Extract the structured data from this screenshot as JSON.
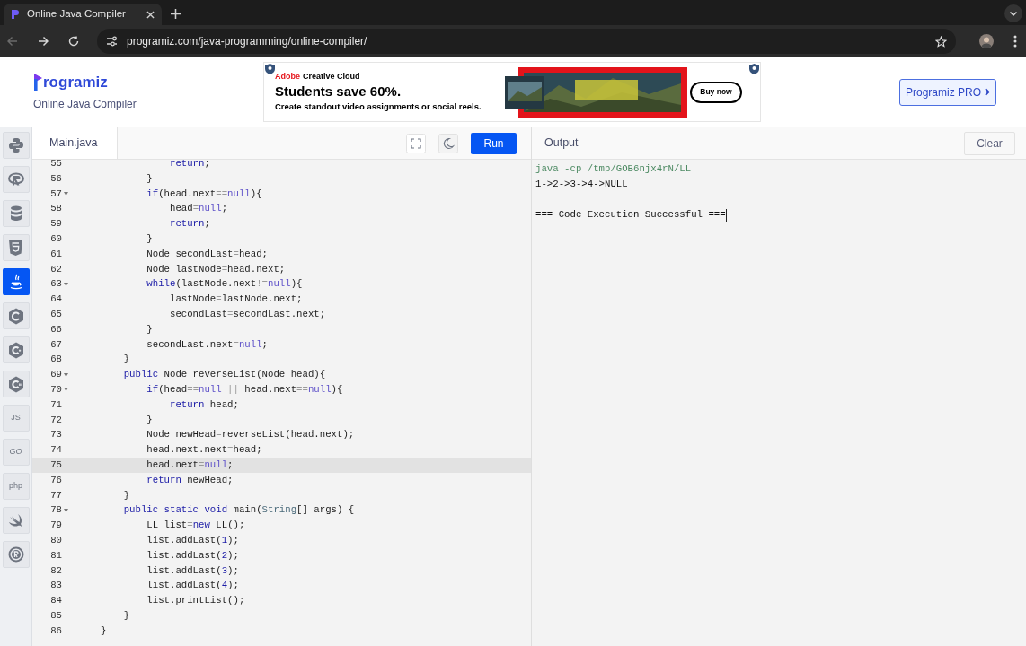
{
  "browser": {
    "tabs": [
      {
        "title": "Online Java Compiler",
        "selected": true
      }
    ],
    "url": "programiz.com/java-programming/online-compiler/",
    "back_disabled": true
  },
  "site_header": {
    "logo": "rogramiz",
    "subtitle": "Online Java Compiler",
    "pro_button": "Programiz PRO"
  },
  "ad": {
    "brand": "Adobe",
    "product": "Creative Cloud",
    "headline": "Students save 60%.",
    "subline": "Create standout video assignments or social reels.",
    "cta": "Buy now"
  },
  "sidebar": {
    "items": [
      {
        "kind": "python",
        "selected": false
      },
      {
        "kind": "r",
        "selected": false
      },
      {
        "kind": "database",
        "selected": false
      },
      {
        "kind": "html",
        "selected": false
      },
      {
        "kind": "java",
        "selected": true
      },
      {
        "kind": "c",
        "selected": false
      },
      {
        "kind": "cpp",
        "selected": false
      },
      {
        "kind": "csharp",
        "selected": false
      },
      {
        "kind": "text",
        "label": "JS",
        "selected": false
      },
      {
        "kind": "text",
        "label": "GO",
        "selected": false
      },
      {
        "kind": "text",
        "label": "php",
        "selected": false
      },
      {
        "kind": "swift",
        "selected": false
      },
      {
        "kind": "rust",
        "selected": false
      }
    ]
  },
  "editor": {
    "file_tab": "Main.java",
    "run_button": "Run",
    "lines": [
      {
        "number": "55",
        "foldable": false,
        "current": false,
        "tokens": [
          {
            "kind": "kw",
            "text": "            return"
          },
          {
            "kind": "p",
            "text": ";"
          }
        ]
      },
      {
        "number": "56",
        "foldable": false,
        "current": false,
        "tokens": [
          {
            "kind": "p",
            "text": "        }"
          }
        ]
      },
      {
        "number": "57",
        "foldable": true,
        "current": false,
        "tokens": [
          {
            "kind": "kw",
            "text": "        if"
          },
          {
            "kind": "p",
            "text": "(head.next"
          },
          {
            "kind": "op",
            "text": "=="
          },
          {
            "kind": "at",
            "text": "null"
          },
          {
            "kind": "p",
            "text": "){"
          }
        ]
      },
      {
        "number": "58",
        "foldable": false,
        "current": false,
        "tokens": [
          {
            "kind": "p",
            "text": "            head"
          },
          {
            "kind": "op",
            "text": "="
          },
          {
            "kind": "at",
            "text": "null"
          },
          {
            "kind": "p",
            "text": ";"
          }
        ]
      },
      {
        "number": "59",
        "foldable": false,
        "current": false,
        "tokens": [
          {
            "kind": "kw",
            "text": "            return"
          },
          {
            "kind": "p",
            "text": ";"
          }
        ]
      },
      {
        "number": "60",
        "foldable": false,
        "current": false,
        "tokens": [
          {
            "kind": "p",
            "text": "        }"
          }
        ]
      },
      {
        "number": "61",
        "foldable": false,
        "current": false,
        "tokens": [
          {
            "kind": "p",
            "text": "        Node secondLast"
          },
          {
            "kind": "op",
            "text": "="
          },
          {
            "kind": "p",
            "text": "head;"
          }
        ]
      },
      {
        "number": "62",
        "foldable": false,
        "current": false,
        "tokens": [
          {
            "kind": "p",
            "text": "        Node lastNode"
          },
          {
            "kind": "op",
            "text": "="
          },
          {
            "kind": "p",
            "text": "head.next;"
          }
        ]
      },
      {
        "number": "63",
        "foldable": true,
        "current": false,
        "tokens": [
          {
            "kind": "kw",
            "text": "        while"
          },
          {
            "kind": "p",
            "text": "(lastNode.next"
          },
          {
            "kind": "op",
            "text": "!="
          },
          {
            "kind": "at",
            "text": "null"
          },
          {
            "kind": "p",
            "text": "){"
          }
        ]
      },
      {
        "number": "64",
        "foldable": false,
        "current": false,
        "tokens": [
          {
            "kind": "p",
            "text": "            lastNode"
          },
          {
            "kind": "op",
            "text": "="
          },
          {
            "kind": "p",
            "text": "lastNode.next;"
          }
        ]
      },
      {
        "number": "65",
        "foldable": false,
        "current": false,
        "tokens": [
          {
            "kind": "p",
            "text": "            secondLast"
          },
          {
            "kind": "op",
            "text": "="
          },
          {
            "kind": "p",
            "text": "secondLast.next;"
          }
        ]
      },
      {
        "number": "66",
        "foldable": false,
        "current": false,
        "tokens": [
          {
            "kind": "p",
            "text": "        }"
          }
        ]
      },
      {
        "number": "67",
        "foldable": false,
        "current": false,
        "tokens": [
          {
            "kind": "p",
            "text": "        secondLast.next"
          },
          {
            "kind": "op",
            "text": "="
          },
          {
            "kind": "at",
            "text": "null"
          },
          {
            "kind": "p",
            "text": ";"
          }
        ]
      },
      {
        "number": "68",
        "foldable": false,
        "current": false,
        "tokens": [
          {
            "kind": "p",
            "text": "    }"
          }
        ]
      },
      {
        "number": "69",
        "foldable": true,
        "current": false,
        "tokens": [
          {
            "kind": "kw",
            "text": "    public"
          },
          {
            "kind": "p",
            "text": " Node reverseList(Node head){"
          }
        ]
      },
      {
        "number": "70",
        "foldable": true,
        "current": false,
        "tokens": [
          {
            "kind": "kw",
            "text": "        if"
          },
          {
            "kind": "p",
            "text": "(head"
          },
          {
            "kind": "op",
            "text": "=="
          },
          {
            "kind": "at",
            "text": "null"
          },
          {
            "kind": "op",
            "text": " || "
          },
          {
            "kind": "p",
            "text": "head.next"
          },
          {
            "kind": "op",
            "text": "=="
          },
          {
            "kind": "at",
            "text": "null"
          },
          {
            "kind": "p",
            "text": "){"
          }
        ]
      },
      {
        "number": "71",
        "foldable": false,
        "current": false,
        "tokens": [
          {
            "kind": "kw",
            "text": "            return"
          },
          {
            "kind": "p",
            "text": " head;"
          }
        ]
      },
      {
        "number": "72",
        "foldable": false,
        "current": false,
        "tokens": [
          {
            "kind": "p",
            "text": "        }"
          }
        ]
      },
      {
        "number": "73",
        "foldable": false,
        "current": false,
        "tokens": [
          {
            "kind": "p",
            "text": "        Node newHead"
          },
          {
            "kind": "op",
            "text": "="
          },
          {
            "kind": "p",
            "text": "reverseList(head.next);"
          }
        ]
      },
      {
        "number": "74",
        "foldable": false,
        "current": false,
        "tokens": [
          {
            "kind": "p",
            "text": "        head.next.next"
          },
          {
            "kind": "op",
            "text": "="
          },
          {
            "kind": "p",
            "text": "head;"
          }
        ]
      },
      {
        "number": "75",
        "foldable": false,
        "current": true,
        "tokens": [
          {
            "kind": "p",
            "text": "        head.next"
          },
          {
            "kind": "op",
            "text": "="
          },
          {
            "kind": "at",
            "text": "null"
          },
          {
            "kind": "p",
            "text": ";"
          }
        ]
      },
      {
        "number": "76",
        "foldable": false,
        "current": false,
        "tokens": [
          {
            "kind": "kw",
            "text": "        return"
          },
          {
            "kind": "p",
            "text": " newHead;"
          }
        ]
      },
      {
        "number": "77",
        "foldable": false,
        "current": false,
        "tokens": [
          {
            "kind": "p",
            "text": "    }"
          }
        ]
      },
      {
        "number": "78",
        "foldable": true,
        "current": false,
        "tokens": [
          {
            "kind": "kw",
            "text": "    public static void"
          },
          {
            "kind": "p",
            "text": " main("
          },
          {
            "kind": "ty",
            "text": "String"
          },
          {
            "kind": "p",
            "text": "[] args) {"
          }
        ]
      },
      {
        "number": "79",
        "foldable": false,
        "current": false,
        "tokens": [
          {
            "kind": "p",
            "text": "        LL list"
          },
          {
            "kind": "op",
            "text": "="
          },
          {
            "kind": "kw",
            "text": "new"
          },
          {
            "kind": "p",
            "text": " LL();"
          }
        ]
      },
      {
        "number": "80",
        "foldable": false,
        "current": false,
        "tokens": [
          {
            "kind": "p",
            "text": "        list.addLast("
          },
          {
            "kind": "num",
            "text": "1"
          },
          {
            "kind": "p",
            "text": ");"
          }
        ]
      },
      {
        "number": "81",
        "foldable": false,
        "current": false,
        "tokens": [
          {
            "kind": "p",
            "text": "        list.addLast("
          },
          {
            "kind": "num",
            "text": "2"
          },
          {
            "kind": "p",
            "text": ");"
          }
        ]
      },
      {
        "number": "82",
        "foldable": false,
        "current": false,
        "tokens": [
          {
            "kind": "p",
            "text": "        list.addLast("
          },
          {
            "kind": "num",
            "text": "3"
          },
          {
            "kind": "p",
            "text": ");"
          }
        ]
      },
      {
        "number": "83",
        "foldable": false,
        "current": false,
        "tokens": [
          {
            "kind": "p",
            "text": "        list.addLast("
          },
          {
            "kind": "num",
            "text": "4"
          },
          {
            "kind": "p",
            "text": ");"
          }
        ]
      },
      {
        "number": "84",
        "foldable": false,
        "current": false,
        "tokens": [
          {
            "kind": "p",
            "text": "        list.printList();"
          }
        ]
      },
      {
        "number": "85",
        "foldable": false,
        "current": false,
        "tokens": [
          {
            "kind": "p",
            "text": "    }"
          }
        ]
      },
      {
        "number": "86",
        "foldable": false,
        "current": false,
        "tokens": [
          {
            "kind": "p",
            "text": "}"
          }
        ]
      }
    ]
  },
  "output": {
    "title": "Output",
    "clear_button": "Clear",
    "lines": [
      {
        "kind": "command",
        "text": "java -cp /tmp/GOB6njx4rN/LL"
      },
      {
        "kind": "stdout",
        "text": "1->2->3->4->NULL"
      },
      {
        "kind": "status",
        "text": "=== Code Execution Successful ==="
      }
    ]
  }
}
